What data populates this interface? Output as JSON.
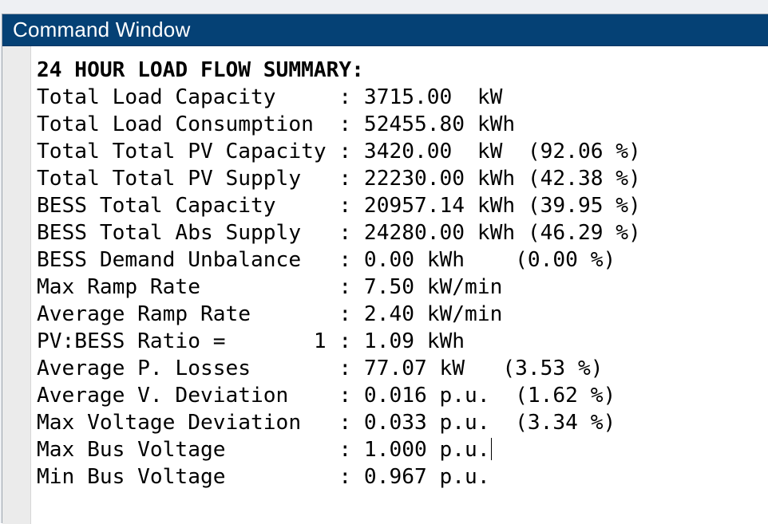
{
  "window": {
    "title": "Command Window"
  },
  "output": {
    "heading": "24 HOUR LOAD FLOW SUMMARY:",
    "lines": [
      "Total Load Capacity     : 3715.00  kW",
      "Total Load Consumption  : 52455.80 kWh",
      "Total Total PV Capacity : 3420.00  kW  (92.06 %)",
      "Total Total PV Supply   : 22230.00 kWh (42.38 %)",
      "BESS Total Capacity     : 20957.14 kWh (39.95 %)",
      "BESS Total Abs Supply   : 24280.00 kWh (46.29 %)",
      "BESS Demand Unbalance   : 0.00 kWh    (0.00 %)",
      "Max Ramp Rate           : 7.50 kW/min",
      "Average Ramp Rate       : 2.40 kW/min",
      "PV:BESS Ratio =       1 : 1.09 kWh",
      "Average P. Losses       : 77.07 kW   (3.53 %)",
      "Average V. Deviation    : 0.016 p.u.  (1.62 %)",
      "Max Voltage Deviation   : 0.033 p.u.  (3.34 %)",
      "Max Bus Voltage         : 1.000 p.u.",
      "Min Bus Voltage         : 0.967 p.u."
    ]
  },
  "colors": {
    "titlebar": "#054175",
    "title_text": "#ffffff",
    "gutter": "#ebebeb",
    "background": "#ffffff",
    "text": "#000000"
  }
}
